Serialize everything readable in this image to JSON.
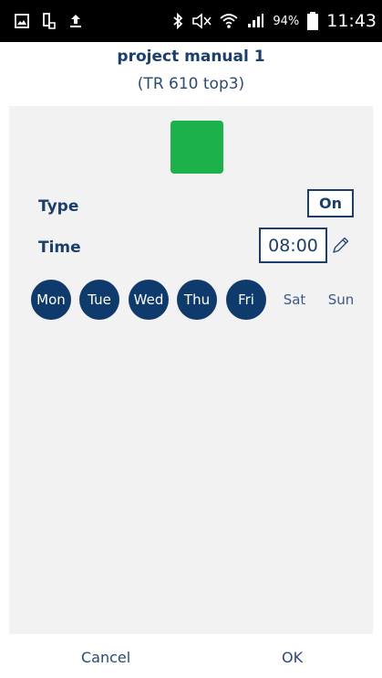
{
  "status_bar": {
    "battery_percent": "94%",
    "time": "11:43",
    "icons": [
      "gallery-icon",
      "screenshot-icon",
      "upload-icon",
      "bluetooth-icon",
      "mute-icon",
      "wifi-icon",
      "signal-icon",
      "battery-icon"
    ]
  },
  "header": {
    "title": "project manual 1",
    "subtitle": "(TR 610 top3)"
  },
  "colors": {
    "accent": "#1b3f6b",
    "day_active": "#0f3b6c",
    "status_square": "#1db14b",
    "content_bg": "#f2f2f2"
  },
  "settings": {
    "type_label": "Type",
    "type_value": "On",
    "time_label": "Time",
    "time_value": "08:00"
  },
  "days": [
    {
      "label": "Mon",
      "active": true
    },
    {
      "label": "Tue",
      "active": true
    },
    {
      "label": "Wed",
      "active": true
    },
    {
      "label": "Thu",
      "active": true
    },
    {
      "label": "Fri",
      "active": true
    },
    {
      "label": "Sat",
      "active": false
    },
    {
      "label": "Sun",
      "active": false
    }
  ],
  "footer": {
    "cancel_label": "Cancel",
    "ok_label": "OK"
  }
}
